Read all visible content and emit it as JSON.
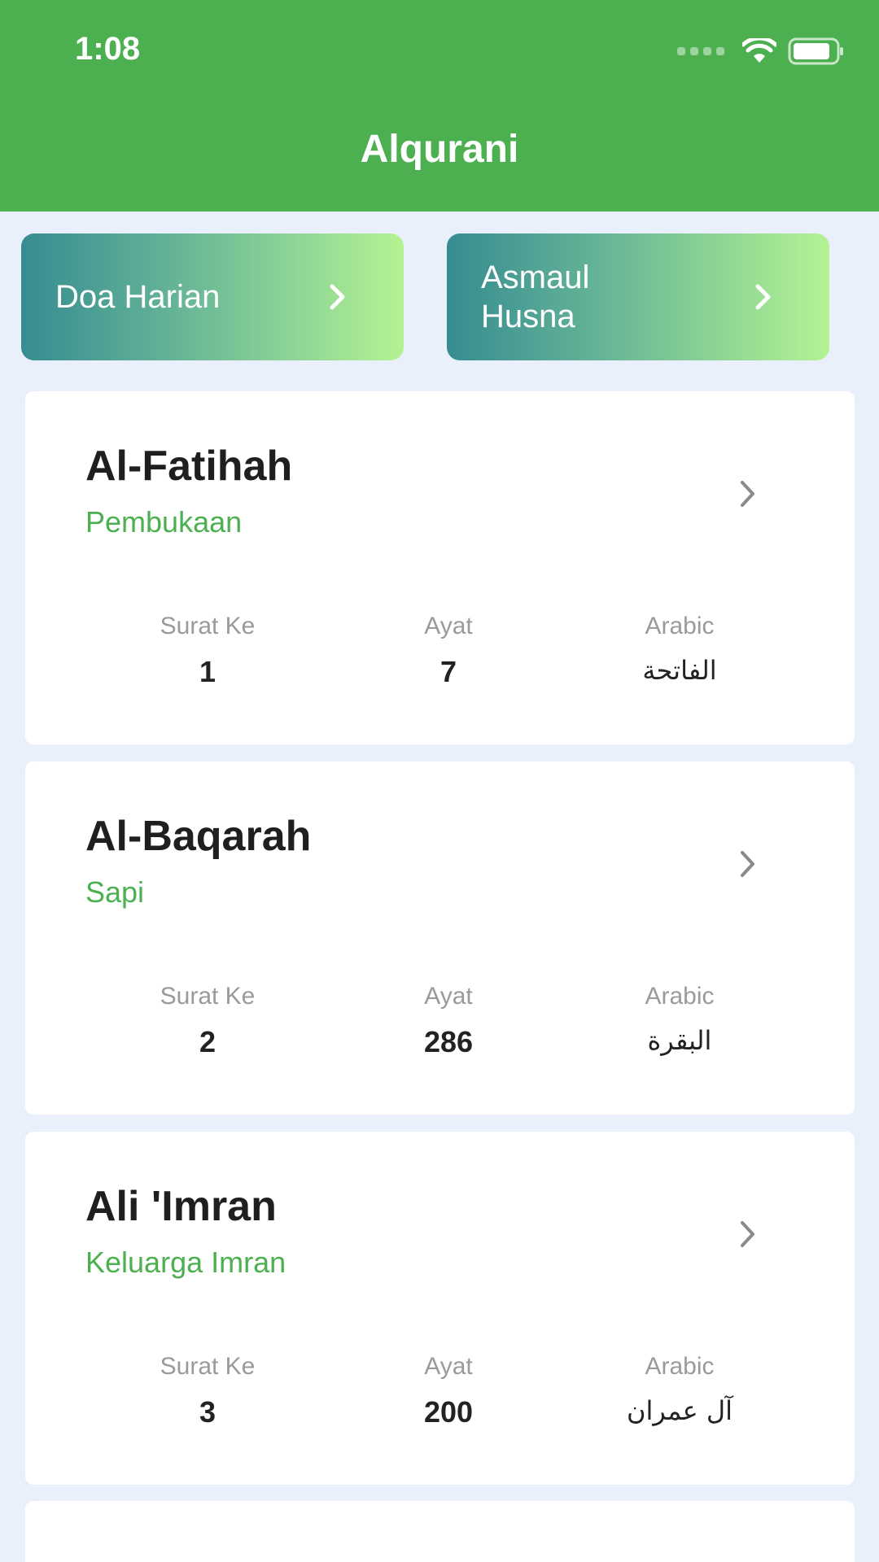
{
  "status_bar": {
    "time": "1:08",
    "icons": [
      "cellular-dots-icon",
      "wifi-icon",
      "battery-icon"
    ]
  },
  "header": {
    "title": "Alqurani",
    "background": "#4caf50"
  },
  "quick_links": [
    {
      "label": "Doa Harian",
      "icon": "chevron-right-icon"
    },
    {
      "label": "Asmaul Husna",
      "icon": "chevron-right-icon"
    }
  ],
  "surahs": [
    {
      "name": "Al-Fatihah",
      "meaning": "Pembukaan",
      "surat_ke_label": "Surat Ke",
      "surat_ke": "1",
      "ayat_label": "Ayat",
      "ayat": "7",
      "arabic_label": "Arabic",
      "arabic": "الفاتحة"
    },
    {
      "name": "Al-Baqarah",
      "meaning": "Sapi",
      "surat_ke_label": "Surat Ke",
      "surat_ke": "2",
      "ayat_label": "Ayat",
      "ayat": "286",
      "arabic_label": "Arabic",
      "arabic": "البقرة"
    },
    {
      "name": "Ali 'Imran",
      "meaning": "Keluarga Imran",
      "surat_ke_label": "Surat Ke",
      "surat_ke": "3",
      "ayat_label": "Ayat",
      "ayat": "200",
      "arabic_label": "Arabic",
      "arabic": "آل عمران"
    }
  ],
  "colors": {
    "accent": "#4caf50",
    "page_background": "#eaf0fb",
    "gradient_start": "#368c91",
    "gradient_end": "#b4f393"
  }
}
